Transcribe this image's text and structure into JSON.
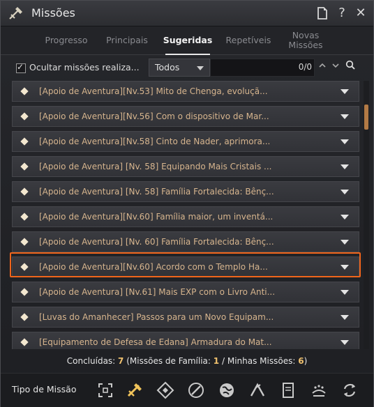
{
  "window": {
    "title": "Missões"
  },
  "titlebar_buttons": {
    "help": "?",
    "close": "✕"
  },
  "tabs": [
    {
      "label": "Progresso",
      "active": false
    },
    {
      "label": "Principais",
      "active": false
    },
    {
      "label": "Sugeridas",
      "active": true
    },
    {
      "label": "Repetíveis",
      "active": false
    },
    {
      "label": "Novas\nMissões",
      "active": false
    }
  ],
  "filter": {
    "hide_completed_label": "Ocultar missões realiza...",
    "hide_completed_checked": true,
    "dropdown_value": "Todos",
    "search_value": "",
    "counter": "0/0"
  },
  "quests": [
    "[Apoio de Aventura][Nv.53] Mito de Chenga, evoluçã...",
    "[Apoio de Aventura][Nv.56] Com o dispositivo de Mar...",
    "[Apoio de Aventura][Nv.58] Cinto de Nader, aprimora...",
    "[Apoio de Aventura] [Nv. 58] Equipando Mais Cristais ...",
    "[Apoio de Aventura] [Nv. 58] Família Fortalecida: Bênç...",
    "[Apoio de Aventura][Nv.60] Família maior, um inventá...",
    "[Apoio de Aventura] [Nv. 60] Família Fortalecida: Bênç...",
    "[Apoio de Aventura][Nv.60] Acordo com o Templo Ha...",
    "[Apoio de Aventura] [Nv.61] Mais EXP com o Livro Anti...",
    "[Luvas do Amanhecer] Passos para um Novo Equipam...",
    "[Equipamento de Defesa de Edana] Armadura do Mat..."
  ],
  "highlighted_quest_index": 7,
  "summary": {
    "completed_label": "Concluídas:",
    "completed_count": "7",
    "family_label": "(Missões de Família:",
    "family_count": "1",
    "mine_label": "/ Minhas Missões:",
    "mine_count": "6",
    "close_paren": ")"
  },
  "bottom": {
    "label": "Tipo de Missão",
    "icons": [
      "all-types-icon",
      "adventure-support-icon",
      "main-quest-icon",
      "combat-icon",
      "world-icon",
      "gathering-icon",
      "book-icon",
      "trade-icon",
      "repeat-icon"
    ]
  },
  "colors": {
    "quest_text": "#d7b58e",
    "highlight_border": "#f0651b",
    "summary_number": "#f0c16e"
  }
}
